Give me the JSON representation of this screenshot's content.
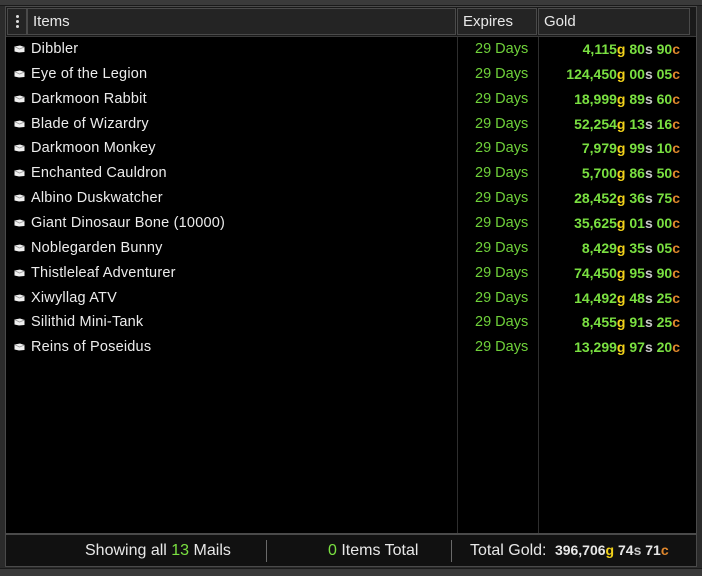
{
  "header": {
    "menu_icon": "kebab-menu-icon",
    "items_label": "Items",
    "expires_label": "Expires",
    "gold_label": "Gold"
  },
  "rows": [
    {
      "name": "Dibbler",
      "expires": "29 Days",
      "gold": "4,115",
      "silver": "80",
      "copper": "90"
    },
    {
      "name": "Eye of the Legion",
      "expires": "29 Days",
      "gold": "124,450",
      "silver": "00",
      "copper": "05"
    },
    {
      "name": "Darkmoon Rabbit",
      "expires": "29 Days",
      "gold": "18,999",
      "silver": "89",
      "copper": "60"
    },
    {
      "name": "Blade of Wizardry",
      "expires": "29 Days",
      "gold": "52,254",
      "silver": "13",
      "copper": "16"
    },
    {
      "name": "Darkmoon Monkey",
      "expires": "29 Days",
      "gold": "7,979",
      "silver": "99",
      "copper": "10"
    },
    {
      "name": "Enchanted Cauldron",
      "expires": "29 Days",
      "gold": "5,700",
      "silver": "86",
      "copper": "50"
    },
    {
      "name": "Albino Duskwatcher",
      "expires": "29 Days",
      "gold": "28,452",
      "silver": "36",
      "copper": "75"
    },
    {
      "name": "Giant Dinosaur Bone (10000)",
      "expires": "29 Days",
      "gold": "35,625",
      "silver": "01",
      "copper": "00"
    },
    {
      "name": "Noblegarden Bunny",
      "expires": "29 Days",
      "gold": "8,429",
      "silver": "35",
      "copper": "05"
    },
    {
      "name": "Thistleleaf Adventurer",
      "expires": "29 Days",
      "gold": "74,450",
      "silver": "95",
      "copper": "90"
    },
    {
      "name": "Xiwyllag ATV",
      "expires": "29 Days",
      "gold": "14,492",
      "silver": "48",
      "copper": "25"
    },
    {
      "name": "Silithid Mini-Tank",
      "expires": "29 Days",
      "gold": "8,455",
      "silver": "91",
      "copper": "25"
    },
    {
      "name": "Reins of Poseidus",
      "expires": "29 Days",
      "gold": "13,299",
      "silver": "97",
      "copper": "20"
    }
  ],
  "currency_suffix": {
    "gold": "g",
    "silver": "s",
    "copper": "c"
  },
  "row_icon": "mail-envelope-icon",
  "footer": {
    "showing_prefix": "Showing all",
    "mail_count": "13",
    "showing_suffix": "Mails",
    "items_count": "0",
    "items_suffix": "Items Total",
    "total_label": "Total Gold:",
    "total_gold": "396,706",
    "total_silver": "74",
    "total_copper": "71"
  },
  "colors": {
    "expires_green": "#6fd13a",
    "gold_amount_green": "#7ae041",
    "gold_suffix": "#f2d21a",
    "silver_suffix": "#c9c9c9",
    "copper_suffix": "#e0872c"
  }
}
